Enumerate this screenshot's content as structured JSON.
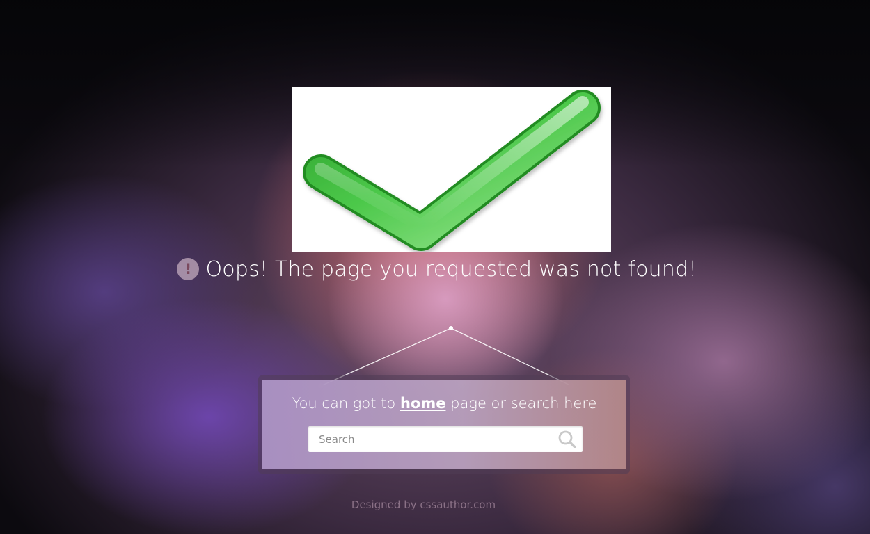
{
  "hero": {
    "icon": "checkmark-icon",
    "colors": {
      "check_light": "#8fe08a",
      "check_mid": "#3cb83c",
      "check_dark": "#1f8f1f"
    }
  },
  "error": {
    "icon": "exclamation-circle-icon",
    "icon_glyph": "!",
    "message": "Oops! The page you requested was not found!"
  },
  "panel": {
    "prefix": "You can got to",
    "link_text": "home",
    "suffix": "page or search here",
    "search": {
      "placeholder": "Search",
      "value": "",
      "icon": "search-icon"
    }
  },
  "footer": {
    "credit": "Designed by cssauthor.com"
  }
}
